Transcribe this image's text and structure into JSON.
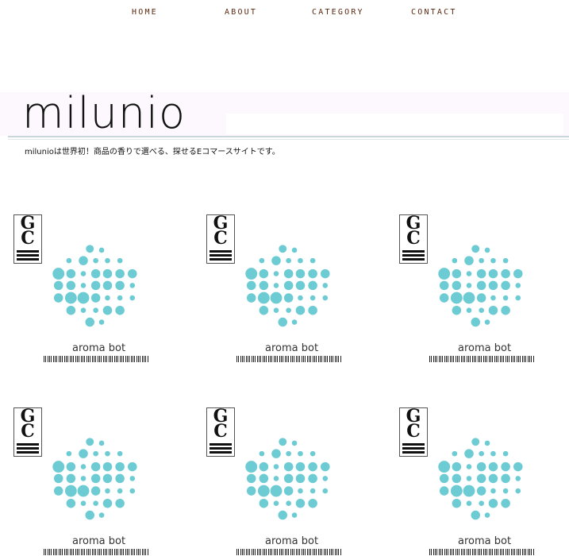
{
  "nav": {
    "items": [
      {
        "label": "HOME",
        "name": "nav-home"
      },
      {
        "label": "ABOUT",
        "name": "nav-about"
      },
      {
        "label": "CATEGORY",
        "name": "nav-category"
      },
      {
        "label": "CONTACT",
        "name": "nav-contact"
      }
    ]
  },
  "hero": {
    "logo_text": "milunio",
    "tagline": "milunioは世界初！商品の香りで選べる、探せるEコマースサイトです。"
  },
  "products": [
    {
      "brand_text": "aroma bot",
      "badge_letters": "GC"
    },
    {
      "brand_text": "aroma bot",
      "badge_letters": "GC"
    },
    {
      "brand_text": "aroma bot",
      "badge_letters": "GC"
    },
    {
      "brand_text": "aroma bot",
      "badge_letters": "GC"
    },
    {
      "brand_text": "aroma bot",
      "badge_letters": "GC"
    },
    {
      "brand_text": "aroma bot",
      "badge_letters": "GC"
    }
  ],
  "colors": {
    "dot": "#6ccbd3",
    "nav_text": "#5a2a10",
    "hero_bg": "#fdf8fd"
  }
}
